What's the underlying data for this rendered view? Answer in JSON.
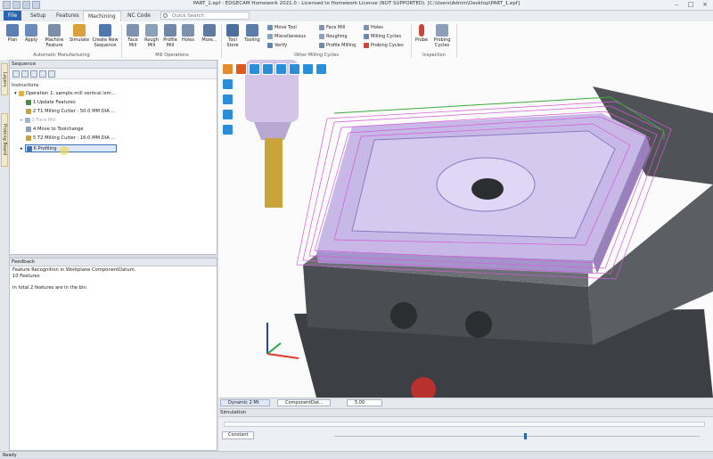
{
  "window": {
    "title": "PART_1.epf - EDGECAM Homework 2021.0 - Licensed to Homework License (NOT SUPPORTED). [C:\\Users\\Admin\\Desktop\\PART_1.epf]"
  },
  "tabs": [
    "File",
    "Setup",
    "Features",
    "Machining",
    "NC Code"
  ],
  "active_tab": "Machining",
  "search": {
    "placeholder": "Quick Search"
  },
  "ribbon": {
    "buttons": [
      {
        "label": "Plan",
        "color": "#5a7fb5"
      },
      {
        "label": "Apply",
        "color": "#6b8bb8"
      },
      {
        "label": "Machine Feature",
        "color": "#7d8fa8"
      },
      {
        "label": "Simulate",
        "color": "#d9a23a"
      },
      {
        "label": "Create New Sequence",
        "color": "#4f78ac"
      },
      {
        "label": "Face Mill",
        "color": "#7e93b0"
      },
      {
        "label": "Rough Mill",
        "color": "#8aa0bb"
      },
      {
        "label": "Profile Mill",
        "color": "#6f87a8"
      },
      {
        "label": "Holes",
        "color": "#7c91ad"
      },
      {
        "label": "More...",
        "color": "#5f7aa0"
      },
      {
        "label": "Tool Store",
        "color": "#4b6e9c"
      },
      {
        "label": "Tooling",
        "color": "#5c7cab"
      },
      {
        "label": "Probe",
        "color": "#c9463d"
      },
      {
        "label": "Probing Cycles",
        "color": "#8b9fb8"
      }
    ],
    "small_buttons": [
      "Move Tool",
      "Miscellaneous",
      "Verify",
      "Face Mill",
      "Roughing",
      "Profile Milling",
      "Holes",
      "Milling Cycles",
      "Probing Cycles"
    ],
    "groups": [
      "Automatic Manufacturing",
      "Mill Operations",
      "Other Milling Cycles",
      "Inspection"
    ]
  },
  "side_tabs": [
    "Layers",
    "Probing Board"
  ],
  "sequence": {
    "title": "Sequence",
    "header": "Instructions",
    "items": [
      "Operation 1: sample mill vertical ism...",
      "1 Update Features",
      "2 T1 Milling Cutter : 50.0 MM DIA ...",
      "3 Face Mill",
      "4 Move to Toolchange",
      "5 T2 Milling Cutter : 16.0 MM DIA ...",
      "6 Profiling"
    ]
  },
  "feedback": {
    "title": "Feedback",
    "lines": [
      "Feature Recognition in Workplane ComponentDatum.",
      "10 Features",
      "In total   2 features are in the bin."
    ]
  },
  "view_bar": {
    "mode": "Dynamic 2 Mt",
    "workplane": "ComponentDat...",
    "value": "5.00"
  },
  "simulation": {
    "title": "Simulation",
    "constant_label": "Constant",
    "progress": 0.52
  },
  "status": "Ready",
  "colors": {
    "accent": "#2a64b3",
    "part": "#c7b8e8",
    "toolpath": "#d45bd4",
    "fixture": "#4a4d52"
  }
}
